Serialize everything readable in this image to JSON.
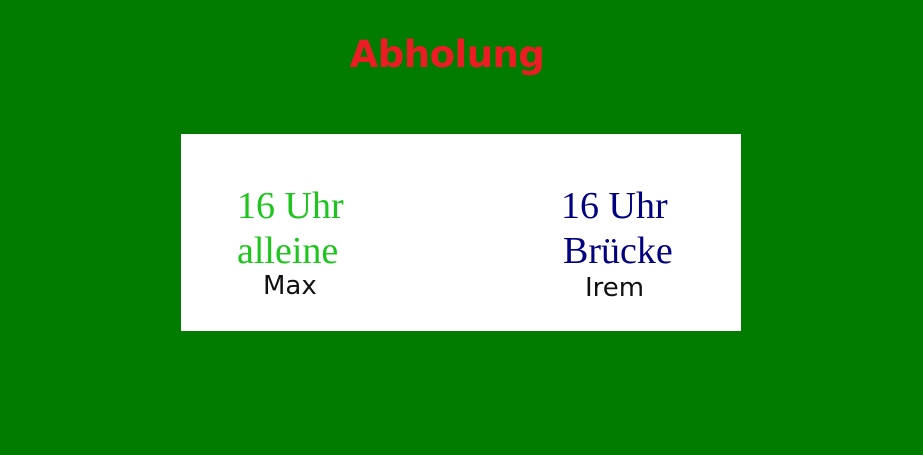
{
  "page": {
    "title": "Abholung",
    "background_color": "#017c01",
    "title_color": "#ec1c24"
  },
  "card": {
    "background_color": "#ffffff",
    "entries": [
      {
        "time": "16 Uhr",
        "place": "alleine",
        "name": "Max",
        "color": "#1ec51e"
      },
      {
        "time": "16 Uhr",
        "place": "Brücke",
        "name": "Irem",
        "color": "#000080"
      }
    ]
  }
}
